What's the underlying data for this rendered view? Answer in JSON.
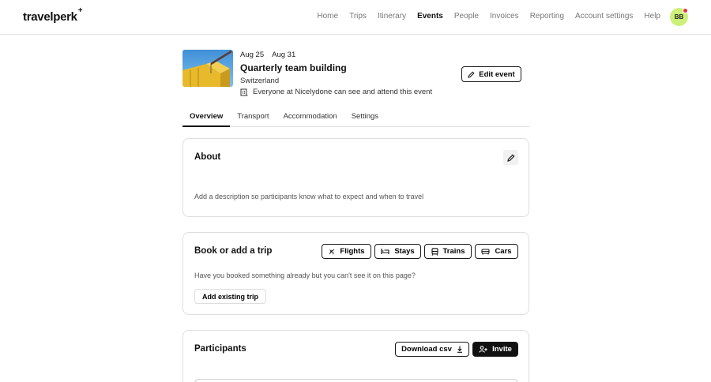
{
  "brand": {
    "logo_text": "travelperk",
    "logo_plus": "+"
  },
  "nav": {
    "items": [
      {
        "label": "Home",
        "active": false
      },
      {
        "label": "Trips",
        "active": false
      },
      {
        "label": "Itinerary",
        "active": false
      },
      {
        "label": "Events",
        "active": true
      },
      {
        "label": "People",
        "active": false
      },
      {
        "label": "Invoices",
        "active": false
      },
      {
        "label": "Reporting",
        "active": false
      },
      {
        "label": "Account settings",
        "active": false
      },
      {
        "label": "Help",
        "active": false
      }
    ],
    "avatar_initials": "BB"
  },
  "event": {
    "start_date": "Aug 25",
    "end_date": "Aug 31",
    "title": "Quarterly team building",
    "location": "Switzerland",
    "visibility": "Everyone at Nicelydone can see and attend this event",
    "edit_label": "Edit event"
  },
  "tabs": [
    {
      "label": "Overview",
      "active": true
    },
    {
      "label": "Transport",
      "active": false
    },
    {
      "label": "Accommodation",
      "active": false
    },
    {
      "label": "Settings",
      "active": false
    }
  ],
  "about": {
    "title": "About",
    "placeholder": "Add a description so participants know what to expect and when to travel"
  },
  "book": {
    "title": "Book or add a trip",
    "options": {
      "flights": "Flights",
      "stays": "Stays",
      "trains": "Trains",
      "cars": "Cars"
    },
    "hint": "Have you booked something already but you can't see it on this page?",
    "add_existing_label": "Add existing trip"
  },
  "participants": {
    "title": "Participants",
    "download_label": "Download csv",
    "invite_label": "Invite"
  },
  "colors": {
    "accent_avatar": "#ccf07a",
    "notification": "#e8323c",
    "primary": "#111111"
  }
}
